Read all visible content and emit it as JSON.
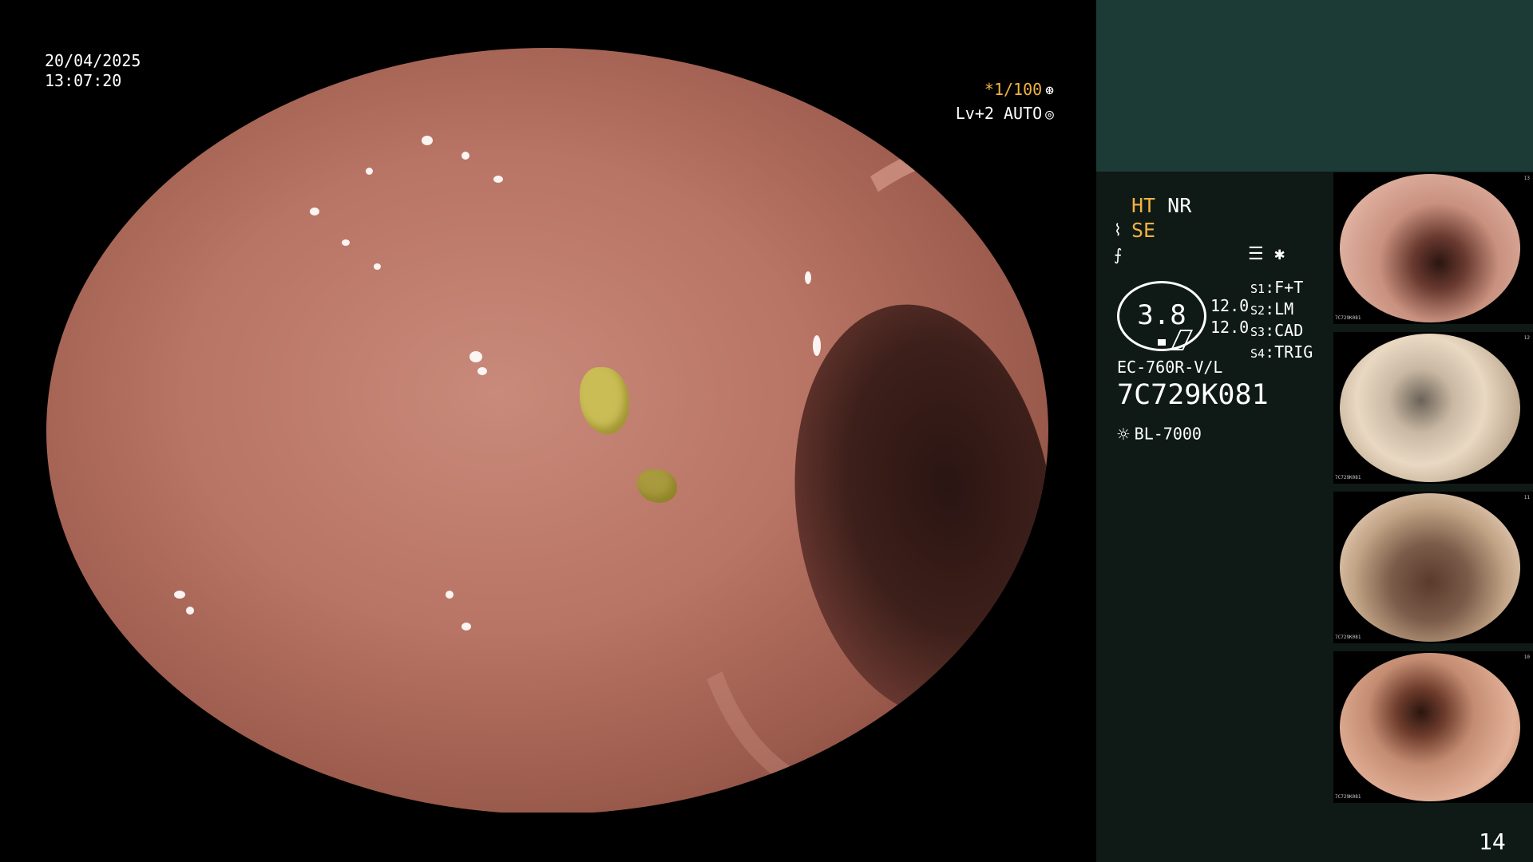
{
  "osd": {
    "date": "20/04/2025",
    "time": "13:07:20",
    "zoom": "*1/100",
    "level": "Lv+2",
    "mode": "AUTO"
  },
  "panel": {
    "ht": "HT",
    "nr": "NR",
    "se": "SE",
    "gauge_value": "3.8",
    "gauge_num_1": "12.0",
    "gauge_num_2": "12.0",
    "scenes": [
      {
        "key": "S1",
        "value": "F+T"
      },
      {
        "key": "S2",
        "value": "LM"
      },
      {
        "key": "S3",
        "value": "CAD"
      },
      {
        "key": "S4",
        "value": "TRIG"
      }
    ],
    "scope_model": "EC-760R-V/L",
    "serial": "7C729K081",
    "light_source": "BL-7000"
  },
  "thumbnails": [
    {
      "serial": "7C729K081",
      "index": "13"
    },
    {
      "serial": "7C729K081",
      "index": "12"
    },
    {
      "serial": "7C729K081",
      "index": "11"
    },
    {
      "serial": "7C729K081",
      "index": "10"
    }
  ],
  "page_number": "14",
  "icons": {
    "aperture": "aperture-icon",
    "auto": "auto-iris-icon",
    "cable": "cable-icon",
    "filter": "filter-icon",
    "menu": "menu-icon",
    "star": "asterisk-icon",
    "light": "light-source-icon"
  }
}
